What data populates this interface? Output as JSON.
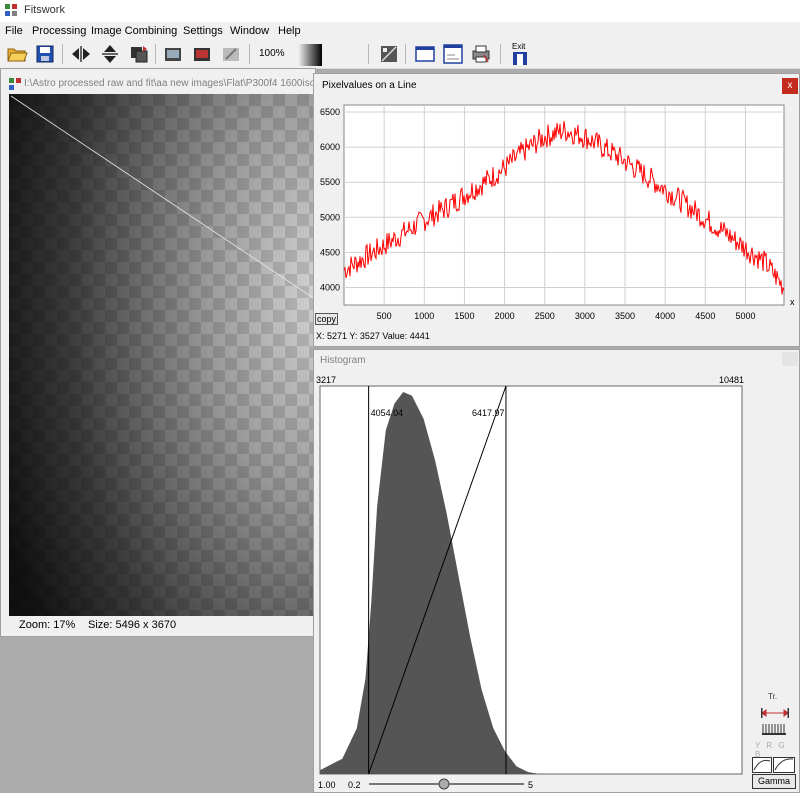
{
  "app": {
    "title": "Fitswork"
  },
  "menu": [
    "File",
    "Processing",
    "Image Combining",
    "Settings",
    "Window",
    "Help"
  ],
  "toolbar": {
    "zoom": "100%",
    "exit_label": "Exit",
    "icons": [
      "open-folder-icon",
      "save-icon",
      "flip-horizontal-icon",
      "flip-vertical-icon",
      "rotate-icon",
      "image-tool-1-icon",
      "image-tool-2-icon",
      "image-tool-3-icon",
      "slider-tool-icon",
      "window-tool-1-icon",
      "window-tool-2-icon",
      "print-icon",
      "exit-icon"
    ]
  },
  "image_window": {
    "title": "I:\\Astro processed raw and fit\\aa new images\\Flat\\P300f4 1600iso",
    "zoom_label": "Zoom: 17%",
    "size_label": "Size: 5496 x 3670"
  },
  "line_window": {
    "title": "Pixelvalues on a Line",
    "close": "x",
    "copy": "copy",
    "info": "X: 5271  Y: 3527  Value: 4441",
    "axis_x_label": "x"
  },
  "chart_data": [
    {
      "type": "line",
      "title": "Pixelvalues on a Line",
      "xlabel": "x",
      "ylabel": "",
      "xlim": [
        0,
        5480
      ],
      "ylim": [
        3750,
        6600
      ],
      "xticks": [
        500,
        1000,
        1500,
        2000,
        2500,
        3000,
        3500,
        4000,
        4500,
        5000
      ],
      "yticks": [
        4000,
        4500,
        5000,
        5500,
        6000,
        6500
      ],
      "grid": true,
      "color": "#ff0000",
      "series": [
        {
          "x": [
            0,
            250,
            500,
            750,
            1000,
            1250,
            1500,
            1750,
            2000,
            2250,
            2500,
            2750,
            3000,
            3250,
            3500,
            3750,
            4000,
            4250,
            4500,
            4750,
            5000,
            5250,
            5480
          ],
          "values": [
            4250,
            4420,
            4600,
            4780,
            4960,
            5120,
            5320,
            5500,
            5700,
            5950,
            6150,
            6240,
            6150,
            5980,
            5800,
            5600,
            5400,
            5190,
            4980,
            4780,
            4560,
            4350,
            4000
          ]
        }
      ]
    },
    {
      "type": "area",
      "title": "Histogram",
      "xlim": [
        3217,
        10481
      ],
      "range_labels": {
        "min": "3217",
        "max": "10481"
      },
      "markers": [
        {
          "label": "4054.04",
          "x": 4054.04
        },
        {
          "label": "6417.97",
          "x": 6417.97
        }
      ],
      "gamma": {
        "left": "1.00",
        "slider_min": "0.2",
        "slider_max": "5"
      },
      "color": "#555555",
      "series": [
        {
          "x": [
            3217,
            3600,
            3850,
            4000,
            4100,
            4200,
            4350,
            4500,
            4650,
            4800,
            5000,
            5200,
            5400,
            5600,
            5800,
            6000,
            6200,
            6400,
            6600,
            6800,
            7000
          ],
          "values": [
            0.01,
            0.04,
            0.12,
            0.25,
            0.45,
            0.7,
            0.9,
            0.97,
            1.0,
            0.99,
            0.93,
            0.82,
            0.68,
            0.52,
            0.36,
            0.22,
            0.12,
            0.06,
            0.02,
            0.005,
            0
          ]
        }
      ]
    }
  ],
  "histogram_window": {
    "title": "Histogram",
    "gamma_button": "Gamma",
    "tr_label": "Tr.",
    "channels": "Y R G B"
  }
}
